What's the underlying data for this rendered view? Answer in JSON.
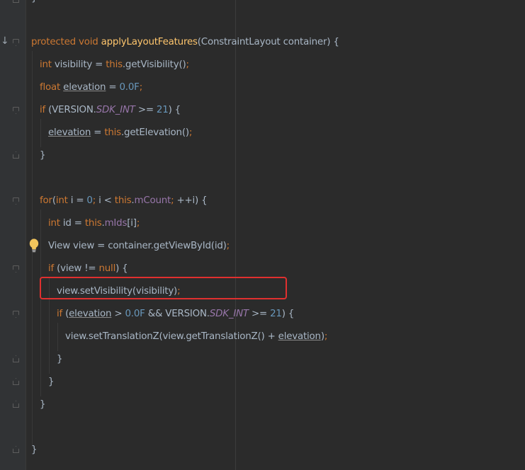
{
  "code": {
    "l1": {
      "t1": "protected",
      "t2": " ",
      "t3": "void",
      "t4": " ",
      "t5": "applyLayoutFeatures",
      "t6": "(ConstraintLayout container) {"
    },
    "l2": {
      "t1": "int",
      "t2": " visibility = ",
      "t3": "this",
      "t4": ".getVisibility()",
      "t5": ";"
    },
    "l3": {
      "t1": "float",
      "t2": " ",
      "t3": "elevation",
      "t4": " = ",
      "t5": "0.0F",
      "t6": ";"
    },
    "l4": {
      "t1": "if",
      "t2": " (VERSION.",
      "t3": "SDK_INT",
      "t4": " >= ",
      "t5": "21",
      "t6": ") {"
    },
    "l5": {
      "t1": "elevation",
      "t2": " = ",
      "t3": "this",
      "t4": ".getElevation()",
      "t5": ";"
    },
    "l6": {
      "t1": "}"
    },
    "l7": {
      "t1": "for",
      "t2": "(",
      "t3": "int",
      "t4": " i = ",
      "t5": "0",
      "t6": "; ",
      "t7": "i < ",
      "t8": "this",
      "t9": ".",
      "t10": "mCount",
      "t11": "; ",
      "t12": "++i) {"
    },
    "l8": {
      "t1": "int",
      "t2": " id = ",
      "t3": "this",
      "t4": ".",
      "t5": "mIds",
      "t6": "[i]",
      "t7": ";"
    },
    "l9": {
      "t1": "View view = container.getViewById(id)",
      "t2": ";"
    },
    "l10": {
      "t1": "if",
      "t2": " (view != ",
      "t3": "null",
      "t4": ") {"
    },
    "l11": {
      "t1": "view.setVisibility(visibility)",
      "t2": ";"
    },
    "l12": {
      "t1": "if",
      "t2": " (",
      "t3": "elevation",
      "t4": " > ",
      "t5": "0.0F",
      "t6": " && VERSION.",
      "t7": "SDK_INT",
      "t8": " >= ",
      "t9": "21",
      "t10": ") {"
    },
    "l13": {
      "t1": "view.setTranslationZ(view.getTranslationZ() + ",
      "t2": "elevation",
      "t3": ")",
      "t4": ";"
    },
    "l14": {
      "t1": "}"
    },
    "l15": {
      "t1": "}"
    },
    "l16": {
      "t1": "}"
    },
    "l17": {
      "t1": "}"
    }
  },
  "gutter": {
    "override_marker_glyph": "↓"
  },
  "colors": {
    "background": "#2b2b2b",
    "gutter": "#313335",
    "keyword": "#cc7832",
    "method_declaration": "#ffc66d",
    "field": "#9876aa",
    "number": "#6897bb",
    "default_text": "#a9b7c6",
    "highlight_box": "#e0302f",
    "bulb": "#f2c55c"
  },
  "icons": {
    "override": "override-arrow-icon",
    "intention": "lightbulb-icon",
    "fold": "fold-marker-icon"
  }
}
